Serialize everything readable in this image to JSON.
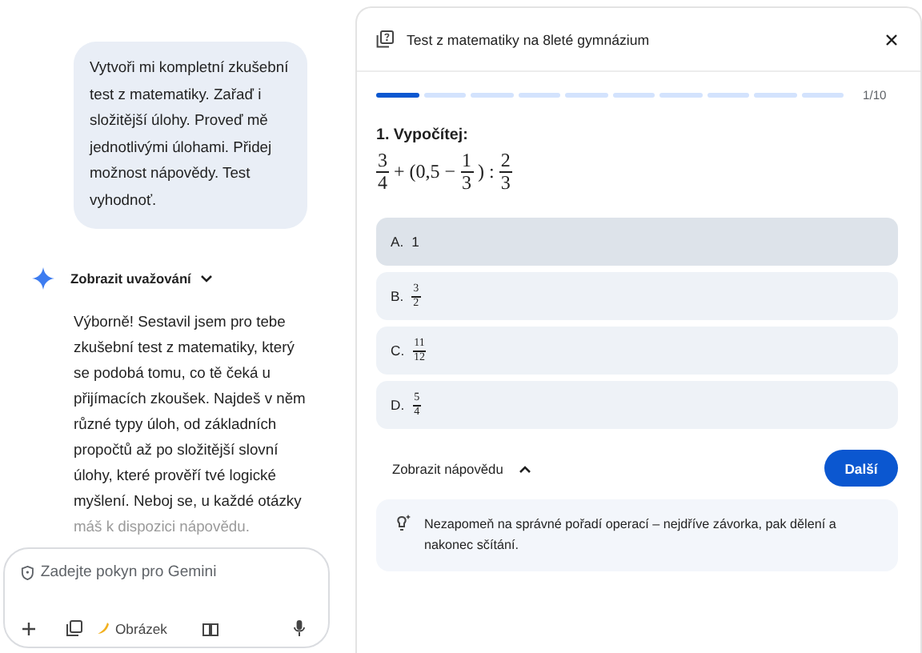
{
  "chat": {
    "user_message": "Vytvoři mi kompletní zkušební test z matematiky. Zařaď i složitější úlohy. Proveď mě jednotlivými úlohami. Přidej možnost nápovědy. Test vyhodnoť.",
    "thinking_toggle": {
      "label": "Zobrazit uvažování",
      "expanded": false
    },
    "response": "Výborně! Sestavil jsem pro tebe zkušební test z matematiky, který se podobá tomu, co tě čeká u přijímacích zkoušek. Najdeš v něm různé typy úloh, od základních propočtů až po složitější slovní úlohy, které prověří tvé logické myšlení. Neboj se, u každé otázky",
    "response_faded": "máš k dispozici nápovědu.",
    "input": {
      "placeholder": "Zadejte pokyn pro Gemini",
      "image_tool": "Obrázek"
    }
  },
  "panel": {
    "title": "Test z matematiky na 8leté gymnázium",
    "progress": {
      "steps": [
        {
          "done": true
        },
        {
          "done": false
        },
        {
          "done": false
        },
        {
          "done": false
        },
        {
          "done": false
        },
        {
          "done": false
        },
        {
          "done": false
        },
        {
          "done": false
        },
        {
          "done": false
        },
        {
          "done": false
        }
      ],
      "counter": "1/10"
    },
    "question": "1. Vypočítej:",
    "formula": [
      {
        "kind": "frac",
        "num": "3",
        "den": "4"
      },
      {
        "kind": "text",
        "text": "+ (0,5 −"
      },
      {
        "kind": "frac",
        "num": "1",
        "den": "3"
      },
      {
        "kind": "text",
        "text": ") :"
      },
      {
        "kind": "frac",
        "num": "2",
        "den": "3"
      }
    ],
    "options": [
      {
        "letter": "A.",
        "selected": true,
        "value": {
          "kind": "text",
          "text": "1"
        }
      },
      {
        "letter": "B.",
        "selected": false,
        "value": {
          "kind": "frac",
          "num": "3",
          "den": "2"
        }
      },
      {
        "letter": "C.",
        "selected": false,
        "value": {
          "kind": "frac",
          "num": "11",
          "den": "12"
        }
      },
      {
        "letter": "D.",
        "selected": false,
        "value": {
          "kind": "frac",
          "num": "5",
          "den": "4"
        }
      }
    ],
    "hint_toggle": {
      "label": "Zobrazit nápovědu",
      "expanded": true
    },
    "next_button": "Další",
    "hint": "Nezapomeň na správné pořadí operací – nejdříve závorka, pak dělení a nakonec sčítání."
  }
}
